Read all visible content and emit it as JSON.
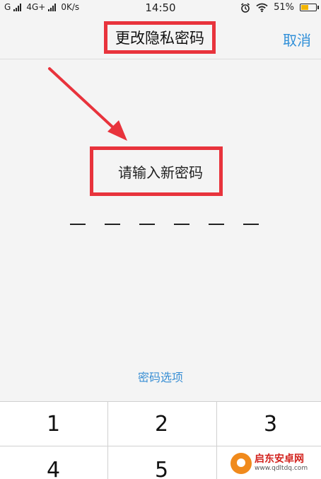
{
  "status_bar": {
    "carrier1": "G",
    "carrier2": "4G+",
    "speed": "0K/s",
    "time": "14:50",
    "battery_percent": "51%",
    "battery_level": 0.51,
    "icons": [
      "signal-icon",
      "alarm-icon",
      "wifi-icon",
      "battery-icon"
    ]
  },
  "header": {
    "title": "更改隐私密码",
    "cancel_label": "取消"
  },
  "main": {
    "prompt": "请输入新密码",
    "pin_length": 6,
    "options_label": "密码选项"
  },
  "keypad": {
    "keys": [
      "1",
      "2",
      "3",
      "4",
      "5",
      ""
    ]
  },
  "watermark": {
    "name": "启东安卓网",
    "url": "www.qdltdq.com"
  },
  "colors": {
    "accent": "#2f8fd8",
    "highlight": "#e8333c",
    "background": "#f4f4f4"
  }
}
